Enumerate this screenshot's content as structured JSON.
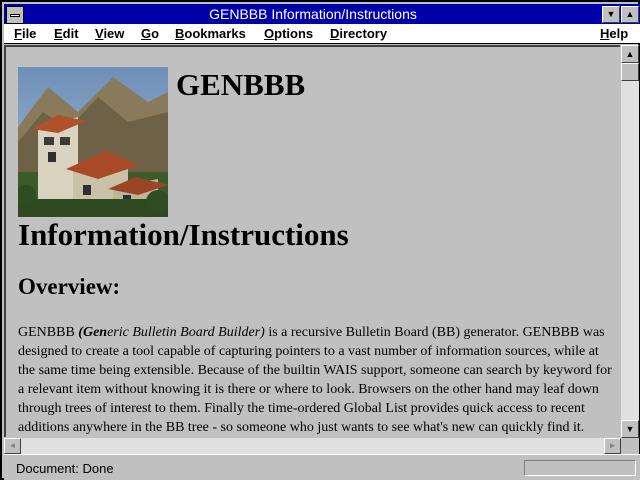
{
  "window": {
    "title": "GENBBB Information/Instructions",
    "minimize_glyph": "▼",
    "maximize_glyph": "▲"
  },
  "menu": [
    {
      "key": "F",
      "rest": "ile"
    },
    {
      "key": "E",
      "rest": "dit"
    },
    {
      "key": "V",
      "rest": "iew"
    },
    {
      "key": "G",
      "rest": "o"
    },
    {
      "key": "B",
      "rest": "ookmarks"
    },
    {
      "key": "O",
      "rest": "ptions"
    },
    {
      "key": "D",
      "rest": "irectory"
    },
    {
      "key": "H",
      "rest": "elp"
    }
  ],
  "content": {
    "site_title": "GENBBB",
    "heading": "Information/Instructions",
    "subheading": "Overview:",
    "para_start": "GENBBB ",
    "para_em_prefix": "(Gen",
    "para_em_rest": "eric Bulletin Board Builder)",
    "para_rest": " is a recursive Bulletin Board (BB) generator. GENBBB was designed to create a tool capable of capturing pointers to a vast number of information sources, while at the same time being extensible. Because of the builtin WAIS support, someone can search by keyword for a relevant item without knowing it is there or where to look. Browsers on the other hand may leaf down through trees of interest to them. Finally the time-ordered Global List provides quick access to recent additions anywhere in the BB tree - so someone who just wants to see what's new can quickly find it."
  },
  "scrollbar": {
    "up_glyph": "▲",
    "down_glyph": "▼",
    "left_glyph": "◄",
    "right_glyph": "►"
  },
  "status": {
    "text": "Document: Done"
  }
}
